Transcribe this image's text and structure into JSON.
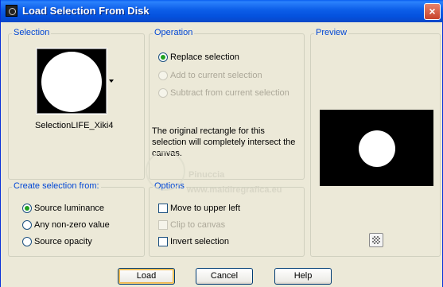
{
  "window": {
    "title": "Load Selection From Disk",
    "close_glyph": "×"
  },
  "selection": {
    "group_label": "Selection",
    "name": "SelectionLIFE_Xiki4"
  },
  "operation": {
    "group_label": "Operation",
    "options": [
      {
        "label": "Replace selection",
        "checked": true,
        "enabled": true
      },
      {
        "label": "Add to current selection",
        "checked": false,
        "enabled": false
      },
      {
        "label": "Subtract from current selection",
        "checked": false,
        "enabled": false
      }
    ],
    "info_text": "The original rectangle for this selection will completely intersect the canvas."
  },
  "preview": {
    "group_label": "Preview"
  },
  "create_from": {
    "group_label": "Create selection from:",
    "options": [
      {
        "label": "Source luminance",
        "checked": true
      },
      {
        "label": "Any non-zero value",
        "checked": false
      },
      {
        "label": "Source opacity",
        "checked": false
      }
    ]
  },
  "options": {
    "group_label": "Options",
    "items": [
      {
        "label": "Move to upper left",
        "checked": false,
        "enabled": true
      },
      {
        "label": "Clip to canvas",
        "checked": false,
        "enabled": false
      },
      {
        "label": "Invert selection",
        "checked": false,
        "enabled": true
      }
    ]
  },
  "buttons": {
    "load": "Load",
    "cancel": "Cancel",
    "help": "Help"
  },
  "watermark": {
    "line1": "Pinuccia",
    "line2": "www.maidiregrafica.eu"
  },
  "icons": {
    "title": "app-icon",
    "dropdown": "chevron-down-icon",
    "preview_toggle": "checkerboard-icon"
  },
  "colors": {
    "title_bar": "#0a5ef0",
    "group_label": "#0046d5",
    "dialog_bg": "#ece9d8"
  }
}
